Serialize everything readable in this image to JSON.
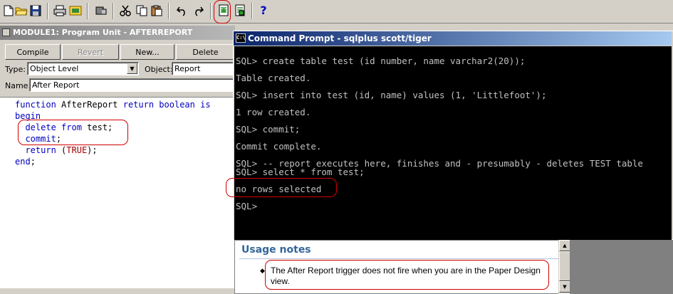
{
  "module": {
    "title": "MODULE1: Program Unit - AFTERREPORT",
    "buttons": {
      "compile": "Compile",
      "revert": "Revert",
      "new": "New...",
      "delete": "Delete"
    },
    "type_label": "Type:",
    "type_value": "Object Level",
    "object_label": "Object:",
    "object_value": "Report",
    "name_label": "Name:",
    "name_value": "After Report",
    "code": [
      [
        {
          "t": "function",
          "k": "kw"
        },
        {
          "t": " AfterReport "
        },
        {
          "t": "return boolean is",
          "k": "kw"
        }
      ],
      [
        {
          "t": "begin",
          "k": "kw"
        }
      ],
      [
        {
          "t": "  "
        },
        {
          "t": "delete from",
          "k": "kw"
        },
        {
          "t": " test;"
        }
      ],
      [
        {
          "t": "  "
        },
        {
          "t": "commit",
          "k": "kw"
        },
        {
          "t": ";"
        }
      ],
      [
        {
          "t": "  "
        },
        {
          "t": "return",
          "k": "kw"
        },
        {
          "t": " ("
        },
        {
          "t": "TRUE",
          "k": "rd"
        },
        {
          "t": ");"
        }
      ],
      [
        {
          "t": "end",
          "k": "kw"
        },
        {
          "t": ";"
        }
      ]
    ]
  },
  "cmd": {
    "title": "Command Prompt - sqlplus scott/tiger",
    "icon_text": "C:\\",
    "lines": [
      "SQL> create table test (id number, name varchar2(20));",
      "",
      "Table created.",
      "",
      "SQL> insert into test (id, name) values (1, 'Littlefoot');",
      "",
      "1 row created.",
      "",
      "SQL> commit;",
      "",
      "Commit complete.",
      "",
      "SQL> -- report executes here, finishes and - presumably - deletes TEST table",
      "SQL> select * from test;",
      "",
      "no rows selected",
      "",
      "SQL>"
    ]
  },
  "usage": {
    "heading": "Usage notes",
    "bullet": "The After Report trigger does not fire when you are in the Paper Design view."
  },
  "toolbar": {
    "icons": [
      "new-icon",
      "open-icon",
      "save-icon",
      "print-icon",
      "print-setup-icon",
      "run-icon",
      "cut-icon",
      "copy-icon",
      "paste-icon",
      "undo-icon",
      "redo-icon",
      "run-report-icon",
      "debug-report-icon",
      "help-icon"
    ],
    "help_glyph": "?"
  },
  "colors": {
    "annotation": "#d00000",
    "console_bg": "#000000",
    "console_fg": "#c0c0c0",
    "title_active": "#0a246a"
  }
}
